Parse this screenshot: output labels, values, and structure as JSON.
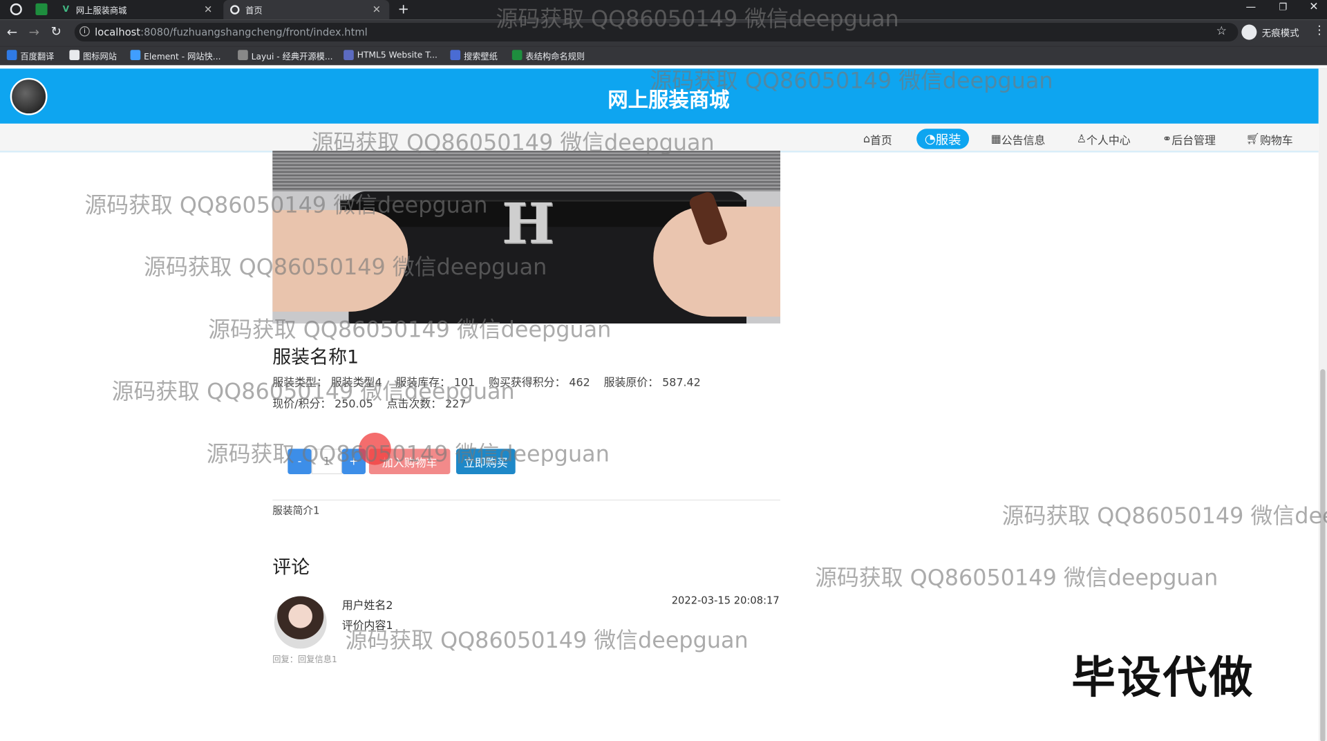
{
  "browser": {
    "tabs": [
      {
        "title": "网上服装商城"
      },
      {
        "title": "首页"
      }
    ],
    "url_host": "localhost",
    "url_path": ":8080/fuzhuangshangcheng/front/index.html",
    "profile_label": "无痕模式",
    "bookmarks": [
      "百度翻译",
      "图标网站",
      "Element - 网站快...",
      "Layui - 经典开源模...",
      "HTML5 Website T...",
      "搜索壁纸",
      "表结构命名规则"
    ]
  },
  "site": {
    "title": "网上服装商城",
    "nav": [
      {
        "label": "首页",
        "icon": "home-icon"
      },
      {
        "label": "服装",
        "icon": "clothes-icon",
        "active": true
      },
      {
        "label": "公告信息",
        "icon": "notice-icon"
      },
      {
        "label": "个人中心",
        "icon": "user-icon"
      },
      {
        "label": "后台管理",
        "icon": "link-icon"
      },
      {
        "label": "购物车",
        "icon": "cart-icon"
      }
    ]
  },
  "product": {
    "name": "服装名称1",
    "type_label": "服装类型：",
    "type_value": "服装类型4",
    "stock_label": "服装库存：",
    "stock_value": "101",
    "points_label": "购买获得积分：",
    "points_value": "462",
    "orig_price_label": "服装原价：",
    "orig_price_value": "587.42",
    "price_label": "现价/积分：",
    "price_value": "250.05",
    "clicks_label": "点击次数：",
    "clicks_value": "227",
    "qty_minus": "-",
    "qty_value": "1",
    "qty_plus": "+",
    "add_cart_label": "加入购物车",
    "buy_now_label": "立即购买",
    "intro": "服装简介1"
  },
  "comments": {
    "heading": "评论",
    "items": [
      {
        "user": "用户姓名2",
        "time": "2022-03-15 20:08:17",
        "content": "评价内容1",
        "reply": "回复：回复信息1"
      }
    ]
  },
  "watermark": "源码获取 QQ86050149 微信deepguan",
  "overlay_text": "毕设代做",
  "colors": {
    "accent": "#0ea5f0",
    "add_cart": "#f28a8a",
    "buy_now": "#1e88c8",
    "qty": "#3d8ee8"
  }
}
